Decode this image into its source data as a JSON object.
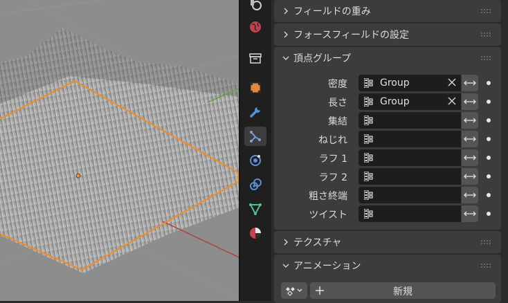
{
  "viewport": {
    "description_icon": "grass-particles-viewport"
  },
  "tabs": [
    {
      "name": "tool-tab",
      "icon": "tool-icon",
      "active": false
    },
    {
      "name": "world-tab",
      "icon": "world-icon",
      "active": false
    },
    {
      "name": "collection-tab",
      "icon": "collection-icon",
      "active": false
    },
    {
      "name": "object-tab",
      "icon": "object-icon",
      "active": false
    },
    {
      "name": "modifier-tab",
      "icon": "wrench-icon",
      "active": false
    },
    {
      "name": "particles-tab",
      "icon": "particles-icon",
      "active": true
    },
    {
      "name": "physics-tab",
      "icon": "physics-icon",
      "active": false
    },
    {
      "name": "constraints-tab",
      "icon": "constraint-icon",
      "active": false
    },
    {
      "name": "data-tab",
      "icon": "mesh-data-icon",
      "active": false
    },
    {
      "name": "material-tab",
      "icon": "material-icon",
      "active": false
    }
  ],
  "panels": {
    "field_weights": "フィールドの重み",
    "force_field": "フォースフィールドの設定",
    "vertex_groups": "頂点グループ",
    "textures": "テクスチャ",
    "animation": "アニメーション"
  },
  "vertex_group_rows": [
    {
      "label": "密度",
      "value": "Group"
    },
    {
      "label": "長さ",
      "value": "Group"
    },
    {
      "label": "集結",
      "value": ""
    },
    {
      "label": "ねじれ",
      "value": ""
    },
    {
      "label": "ラフ 1",
      "value": ""
    },
    {
      "label": "ラフ 2",
      "value": ""
    },
    {
      "label": "粗さ終端",
      "value": ""
    },
    {
      "label": "ツイスト",
      "value": ""
    }
  ],
  "animation": {
    "new_label": "新規"
  },
  "colors": {
    "accent": "#4772b3",
    "selection_orange": "#f08a2a",
    "panel_bg": "#3c3c3c",
    "field_bg": "#1d1d1d"
  }
}
